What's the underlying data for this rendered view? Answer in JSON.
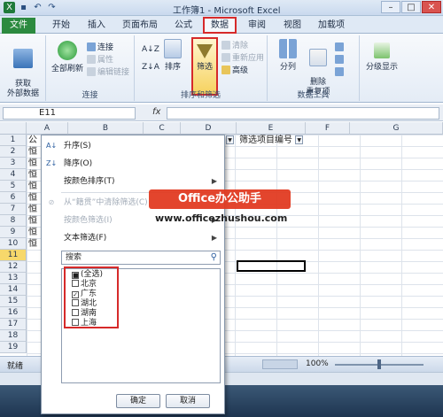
{
  "window": {
    "title": "工作簿1 - Microsoft Excel"
  },
  "ribbon_tabs": [
    "文件",
    "开始",
    "插入",
    "页面布局",
    "公式",
    "数据",
    "审阅",
    "视图",
    "加载项"
  ],
  "ribbon": {
    "get_external": "获取\n外部数据",
    "refresh_all": "全部刷新",
    "connections": "连接",
    "properties": "属性",
    "edit_links": "编辑链接",
    "connections_group": "连接",
    "sort_asc": "A↓Z",
    "sort_desc": "Z↓A",
    "sort": "排序",
    "filter": "筛选",
    "clear": "清除",
    "reapply": "重新应用",
    "advanced": "高级",
    "sort_filter_group": "排序和筛选",
    "text_to_columns": "分列",
    "remove_dup": "删除\n重复项",
    "data_tools_group": "数据工具",
    "outline": "分级显示"
  },
  "formula_bar": {
    "name_box": "E11",
    "fx": "fx"
  },
  "columns": [
    "A",
    "B",
    "C",
    "D",
    "E",
    "F",
    "G"
  ],
  "rows": [
    "1",
    "2",
    "3",
    "4",
    "5",
    "6",
    "7",
    "8",
    "9",
    "10",
    "11",
    "12",
    "13",
    "14",
    "15",
    "16",
    "17",
    "18",
    "19"
  ],
  "cells": {
    "a_col": [
      "公",
      "恒",
      "恒",
      "恒",
      "恒",
      "恒",
      "恒",
      "恒",
      "恒",
      "恒"
    ],
    "e1": "筛选项目编号"
  },
  "dropdown": {
    "sort_asc": "升序(S)",
    "sort_desc": "降序(O)",
    "sort_by_color": "按颜色排序(T)",
    "clear_filter": "从“籍贯”中清除筛选(C)",
    "filter_by_color": "按颜色筛选(I)",
    "text_filter": "文本筛选(F)",
    "search_placeholder": "搜索",
    "items": [
      {
        "label": "(全选)",
        "state": "partial"
      },
      {
        "label": "北京",
        "state": "unchecked"
      },
      {
        "label": "广东",
        "state": "checked"
      },
      {
        "label": "湖北",
        "state": "unchecked"
      },
      {
        "label": "湖南",
        "state": "unchecked"
      },
      {
        "label": "上海",
        "state": "unchecked"
      }
    ],
    "ok": "确定",
    "cancel": "取消"
  },
  "status": {
    "ready": "就绪",
    "zoom": "100%"
  },
  "watermark": {
    "brand": "Office办公助手",
    "url": "www.officezhushou.com"
  },
  "colors": {
    "accent_red": "#d62a2a",
    "file_tab": "#2c8a3f",
    "brand_bg": "#e1381e"
  }
}
